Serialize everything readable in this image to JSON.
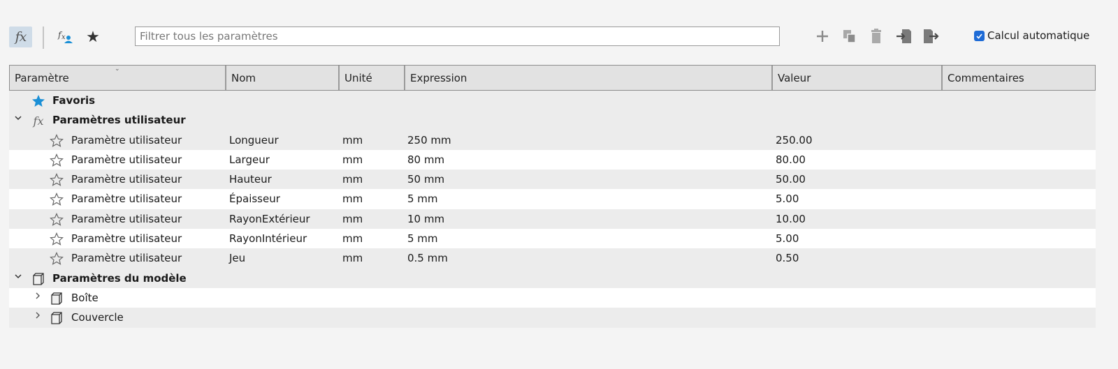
{
  "toolbar": {
    "fx_icon": "fx",
    "filter": {
      "placeholder": "Filtrer tous les paramètres",
      "value": ""
    },
    "auto_calc": {
      "label": "Calcul automatique",
      "checked": true
    },
    "accent_color": "#1e6bd6"
  },
  "table": {
    "columns": [
      "Paramètre",
      "Nom",
      "Unité",
      "Expression",
      "Valeur",
      "Commentaires"
    ],
    "favorites": {
      "label": "Favoris",
      "icon": "star-filled-icon",
      "color": "#1a8fd6"
    },
    "user_group": {
      "label": "Paramètres utilisateur",
      "icon": "fx-icon",
      "rows": [
        {
          "param": "Paramètre utilisateur",
          "name": "Longueur",
          "unit": "mm",
          "expression": "250 mm",
          "value": "250.00",
          "comment": ""
        },
        {
          "param": "Paramètre utilisateur",
          "name": "Largeur",
          "unit": "mm",
          "expression": "80 mm",
          "value": "80.00",
          "comment": ""
        },
        {
          "param": "Paramètre utilisateur",
          "name": "Hauteur",
          "unit": "mm",
          "expression": "50 mm",
          "value": "50.00",
          "comment": ""
        },
        {
          "param": "Paramètre utilisateur",
          "name": "Épaisseur",
          "unit": "mm",
          "expression": "5 mm",
          "value": "5.00",
          "comment": ""
        },
        {
          "param": "Paramètre utilisateur",
          "name": "RayonExtérieur",
          "unit": "mm",
          "expression": "10 mm",
          "value": "10.00",
          "comment": ""
        },
        {
          "param": "Paramètre utilisateur",
          "name": "RayonIntérieur",
          "unit": "mm",
          "expression": "5 mm",
          "value": "5.00",
          "comment": ""
        },
        {
          "param": "Paramètre utilisateur",
          "name": "Jeu",
          "unit": "mm",
          "expression": "0.5 mm",
          "value": "0.50",
          "comment": ""
        }
      ]
    },
    "model_group": {
      "label": "Paramètres du modèle",
      "icon": "cube-icon",
      "children": [
        {
          "label": "Boîte",
          "icon": "cube-icon"
        },
        {
          "label": "Couvercle",
          "icon": "cube-icon"
        }
      ]
    }
  }
}
